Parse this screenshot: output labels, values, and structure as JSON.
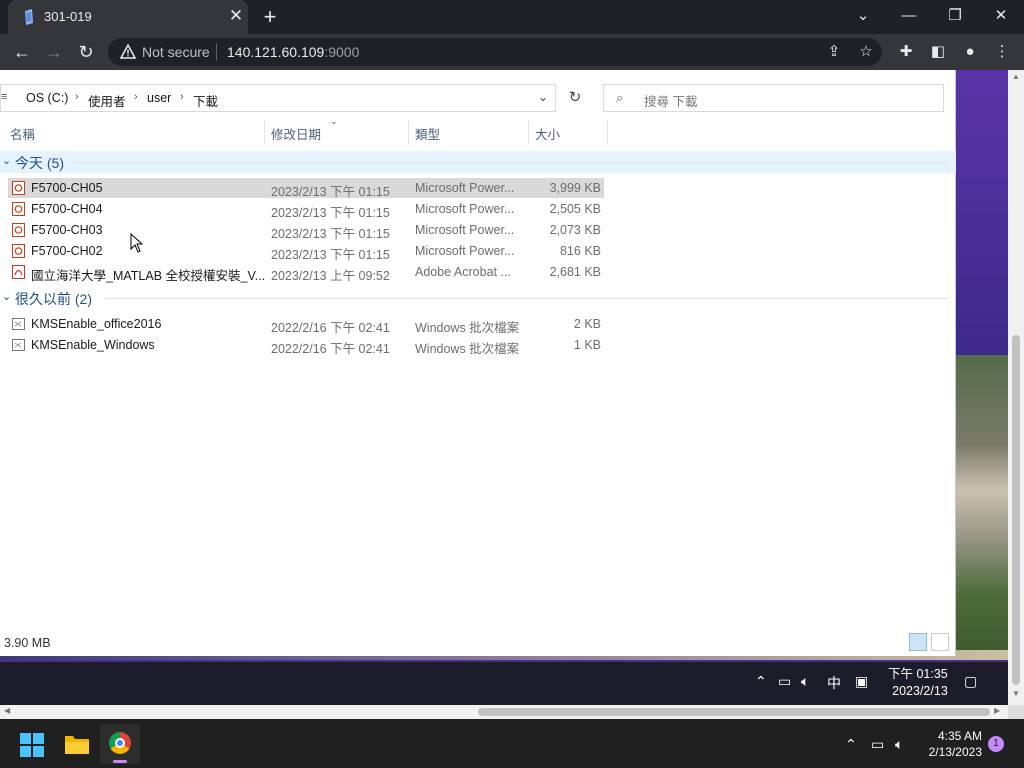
{
  "browser": {
    "tab_title": "301-019",
    "not_secure_label": "Not secure",
    "url_host": "140.121.60.109",
    "url_port": ":9000"
  },
  "explorer": {
    "breadcrumb": [
      "OS (C:)",
      "使用者",
      "user",
      "下載"
    ],
    "search_placeholder": "搜尋 下載",
    "columns": {
      "name": "名稱",
      "date": "修改日期",
      "type": "類型",
      "size": "大小"
    },
    "groups": [
      {
        "title": "今天 (5)",
        "files": [
          {
            "name": "F5700-CH05",
            "date": "2023/2/13 下午 01:15",
            "type": "Microsoft Power...",
            "size": "3,999 KB",
            "icon": "powerpoint-icon",
            "selected": true
          },
          {
            "name": "F5700-CH04",
            "date": "2023/2/13 下午 01:15",
            "type": "Microsoft Power...",
            "size": "2,505 KB",
            "icon": "powerpoint-icon"
          },
          {
            "name": "F5700-CH03",
            "date": "2023/2/13 下午 01:15",
            "type": "Microsoft Power...",
            "size": "2,073 KB",
            "icon": "powerpoint-icon"
          },
          {
            "name": "F5700-CH02",
            "date": "2023/2/13 下午 01:15",
            "type": "Microsoft Power...",
            "size": "816 KB",
            "icon": "powerpoint-icon"
          },
          {
            "name": "國立海洋大學_MATLAB 全校授權安裝_V...",
            "date": "2023/2/13 上午 09:52",
            "type": "Adobe Acrobat ...",
            "size": "2,681 KB",
            "icon": "pdf-icon"
          }
        ]
      },
      {
        "title": "很久以前 (2)",
        "files": [
          {
            "name": "KMSEnable_office2016",
            "date": "2022/2/16 下午 02:41",
            "type": "Windows 批次檔案",
            "size": "2 KB",
            "icon": "batch-file-icon"
          },
          {
            "name": "KMSEnable_Windows",
            "date": "2022/2/16 下午 02:41",
            "type": "Windows 批次檔案",
            "size": "1 KB",
            "icon": "batch-file-icon"
          }
        ]
      }
    ],
    "status_size": "3.90 MB"
  },
  "remote_taskbar": {
    "ime": "中",
    "time": "下午 01:35",
    "date": "2023/2/13"
  },
  "host_taskbar": {
    "time": "4:35 AM",
    "date": "2/13/2023",
    "notification_count": "1"
  },
  "colors": {
    "accent": "#1e4e8a",
    "selection": "#d9d9d9",
    "group_highlight": "#e5f3ff",
    "chrome_dark": "#35363a"
  }
}
